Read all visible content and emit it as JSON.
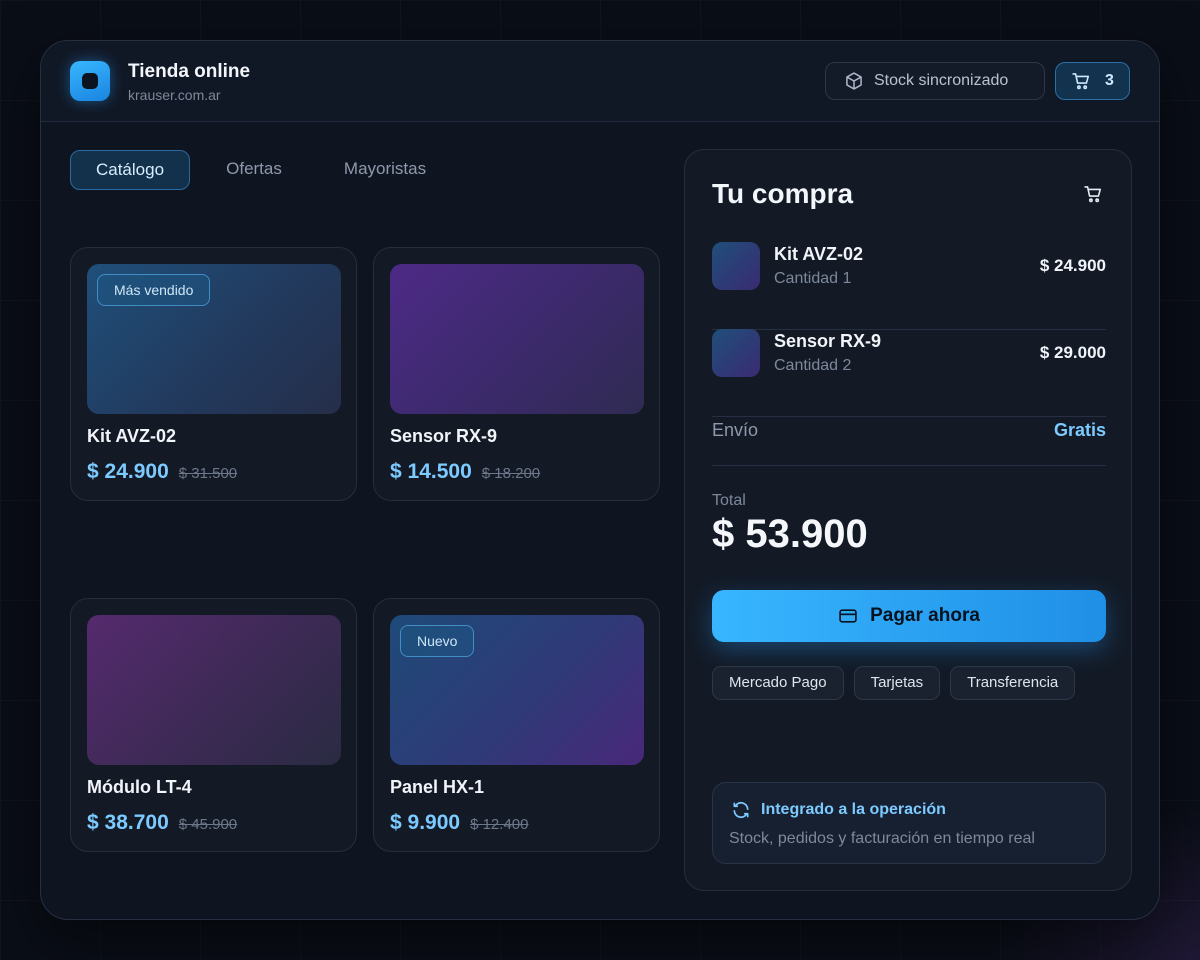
{
  "store": {
    "name": "Tienda online",
    "domain": "krauser.com.ar"
  },
  "header": {
    "stock_label": "Stock sincronizado",
    "cart_count": "3"
  },
  "tabs": [
    {
      "label": "Catálogo",
      "active": true
    },
    {
      "label": "Ofertas",
      "active": false
    },
    {
      "label": "Mayoristas",
      "active": false
    }
  ],
  "products": [
    {
      "name": "Kit AVZ-02",
      "price": "$ 24.900",
      "old_price": "$ 31.500",
      "badge": "Más vendido"
    },
    {
      "name": "Sensor RX-9",
      "price": "$ 14.500",
      "old_price": "$ 18.200",
      "badge": ""
    },
    {
      "name": "Módulo LT-4",
      "price": "$ 38.700",
      "old_price": "$ 45.900",
      "badge": ""
    },
    {
      "name": "Panel HX-1",
      "price": "$ 9.900",
      "old_price": "$ 12.400",
      "badge": "Nuevo"
    }
  ],
  "cart": {
    "title": "Tu compra",
    "items": [
      {
        "name": "Kit AVZ-02",
        "qty": "Cantidad 1",
        "price": "$ 24.900"
      },
      {
        "name": "Sensor RX-9",
        "qty": "Cantidad 2",
        "price": "$ 29.000"
      }
    ],
    "shipping_label": "Envío",
    "shipping_value": "Gratis",
    "total_label": "Total",
    "total_value": "$ 53.900",
    "pay_label": "Pagar ahora",
    "methods": [
      "Mercado Pago",
      "Tarjetas",
      "Transferencia"
    ],
    "integration_title": "Integrado a la operación",
    "integration_desc": "Stock, pedidos y facturación en tiempo real"
  },
  "colors": {
    "accent": "#38b6ff",
    "price": "#7ccaff",
    "background": "#0a0e17",
    "panel": "#131a26"
  },
  "icons": {
    "stock": "box-icon",
    "cart": "cart-icon",
    "pay": "credit-card-icon",
    "integration": "sync-icon"
  }
}
